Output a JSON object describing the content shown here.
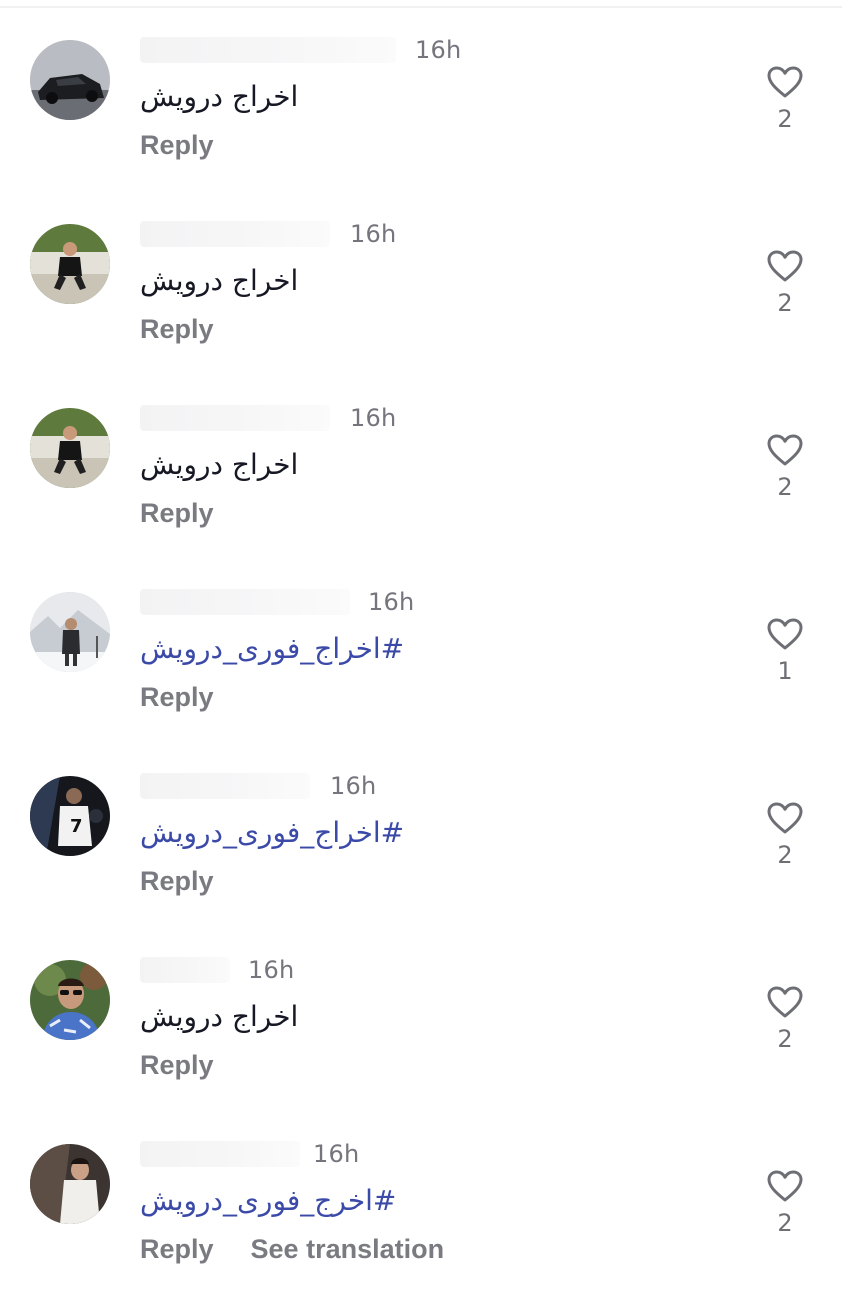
{
  "comments": [
    {
      "time": "16h",
      "text": "اخراج درویش",
      "hashtag": false,
      "likes": "2",
      "reply": "Reply",
      "avatar": "car-photo"
    },
    {
      "time": "16h",
      "text": "اخراج درویش",
      "hashtag": false,
      "likes": "2",
      "reply": "Reply",
      "avatar": "sitting-man"
    },
    {
      "time": "16h",
      "text": "اخراج درویش",
      "hashtag": false,
      "likes": "2",
      "reply": "Reply",
      "avatar": "sitting-man"
    },
    {
      "time": "16h",
      "text": "#اخراج_فوری_درویش",
      "hashtag": true,
      "likes": "1",
      "reply": "Reply",
      "avatar": "snow-man"
    },
    {
      "time": "16h",
      "text": "#اخراج_فوری_درویش",
      "hashtag": true,
      "likes": "2",
      "reply": "Reply",
      "avatar": "footballer"
    },
    {
      "time": "16h",
      "text": "اخراج درویش",
      "hashtag": false,
      "likes": "2",
      "reply": "Reply",
      "avatar": "man-sunglasses"
    },
    {
      "time": "16h",
      "text": "#اخرج_فوری_درویش",
      "hashtag": true,
      "likes": "2",
      "reply": "Reply",
      "avatar": "man-white-shirt",
      "translate": "See translation"
    }
  ],
  "icons": {
    "like": "heart-outline-icon"
  },
  "colors": {
    "text": "#161823",
    "hashtag": "#3b4aa8",
    "muted": "#7a7b80"
  }
}
